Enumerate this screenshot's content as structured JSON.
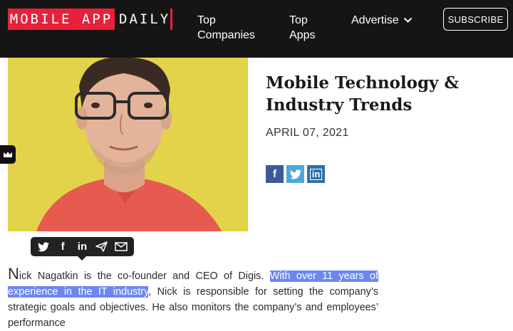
{
  "header": {
    "logo_part1": "MOBILE APP",
    "logo_part2": "DAILY",
    "nav": {
      "top_companies": "Top\nCompanies",
      "top_apps": "Top\nApps",
      "advertise": "Advertise"
    },
    "subscribe": "SUBSCRIBE"
  },
  "article": {
    "title": "Mobile Technology & Industry Trends",
    "date": "APRIL 07, 2021",
    "share": {
      "facebook": "f",
      "twitter": "twitter-icon",
      "linkedin": "in"
    }
  },
  "toolbar": {
    "linkedin": "in"
  },
  "body": {
    "dropcap": "N",
    "part1": "ick Nagatkin is the co-founder and CEO of Digis. ",
    "highlight": "With over 11 years of experience in the IT industry",
    "part2": ", Nick is responsible for setting the company’s strategic goals and objectives. He also monitors the company’s and employees’ performance"
  },
  "colors": {
    "header_bg": "#151515",
    "brand_red": "#e8203a",
    "hero_bg": "#e2d34a",
    "highlight": "#6d86f0",
    "facebook": "#3b5a9a",
    "twitter": "#4da7de",
    "linkedin": "#2e71a8"
  }
}
